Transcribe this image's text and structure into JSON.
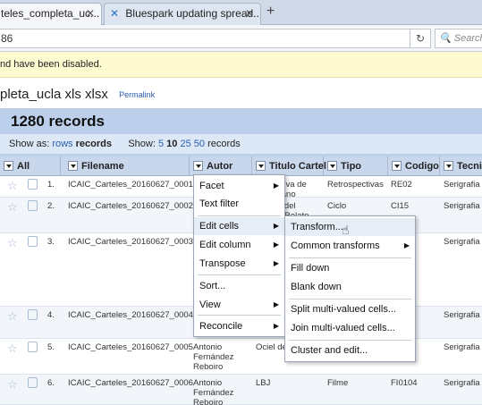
{
  "browser": {
    "tab_active": "teles_completa_uc...",
    "tab_inactive": "Bluespark updating spread...",
    "url": "86",
    "search_placeholder": "Search"
  },
  "notice": "nd have been disabled.",
  "project": {
    "title": "pleta_ucla xls xlsx",
    "permalink": "Permalink",
    "records_count": "1280 records"
  },
  "showbar": {
    "show_as": "Show as:",
    "rows": "rows",
    "records": "records",
    "show": "Show:",
    "sizes": [
      "5",
      "10",
      "25",
      "50"
    ],
    "suffix": "records"
  },
  "columns": [
    "All",
    "Filename",
    "Autor",
    "Titulo Cartel",
    "Tipo",
    "Codigo",
    "Tecni"
  ],
  "rows": [
    {
      "num": "1.",
      "filename": "ICAIC_Carteles_20160627_0001",
      "autor": "",
      "titulo": "ctiva de\ncano",
      "tipo": "Retrospectivas",
      "codigo": "RE02",
      "tecnica": "Serigrafia"
    },
    {
      "num": "2.",
      "filename": "ICAIC_Carteles_20160627_0002",
      "autor": "",
      "titulo": "a del\ne/Relato",
      "tipo": "Ciclo",
      "codigo": "CI15",
      "tecnica": "Serigrafia"
    },
    {
      "num": "3.",
      "filename": "ICAIC_Carteles_20160627_0003",
      "autor": "",
      "titulo": "",
      "tipo": "",
      "codigo": "",
      "tecnica": "Serigrafia"
    },
    {
      "num": "4.",
      "filename": "ICAIC_Carteles_20160627_0004",
      "autor": "",
      "titulo": "",
      "tipo": "",
      "codigo": "",
      "tecnica": "Serigrafia"
    },
    {
      "num": "5.",
      "filename": "ICAIC_Carteles_20160627_0005",
      "autor": "Antonio\nFernández\nReboiro",
      "titulo": "Ociel del",
      "tipo": "",
      "codigo": "",
      "tecnica": "Serigrafia"
    },
    {
      "num": "6.",
      "filename": "ICAIC_Carteles_20160627_0006",
      "autor": "Antonio\nFernández\nReboiro",
      "titulo": "LBJ",
      "tipo": "Filme",
      "codigo": "FI0104",
      "tecnica": "Serigrafia"
    }
  ],
  "column_menu": {
    "facet": "Facet",
    "text_filter": "Text filter",
    "edit_cells": "Edit cells",
    "edit_column": "Edit column",
    "transpose": "Transpose",
    "sort": "Sort...",
    "view": "View",
    "reconcile": "Reconcile"
  },
  "edit_cells_menu": {
    "transform": "Transform...",
    "common_transforms": "Common transforms",
    "fill_down": "Fill down",
    "blank_down": "Blank down",
    "split": "Split multi-valued cells...",
    "join": "Join multi-valued cells...",
    "cluster": "Cluster and edit..."
  }
}
